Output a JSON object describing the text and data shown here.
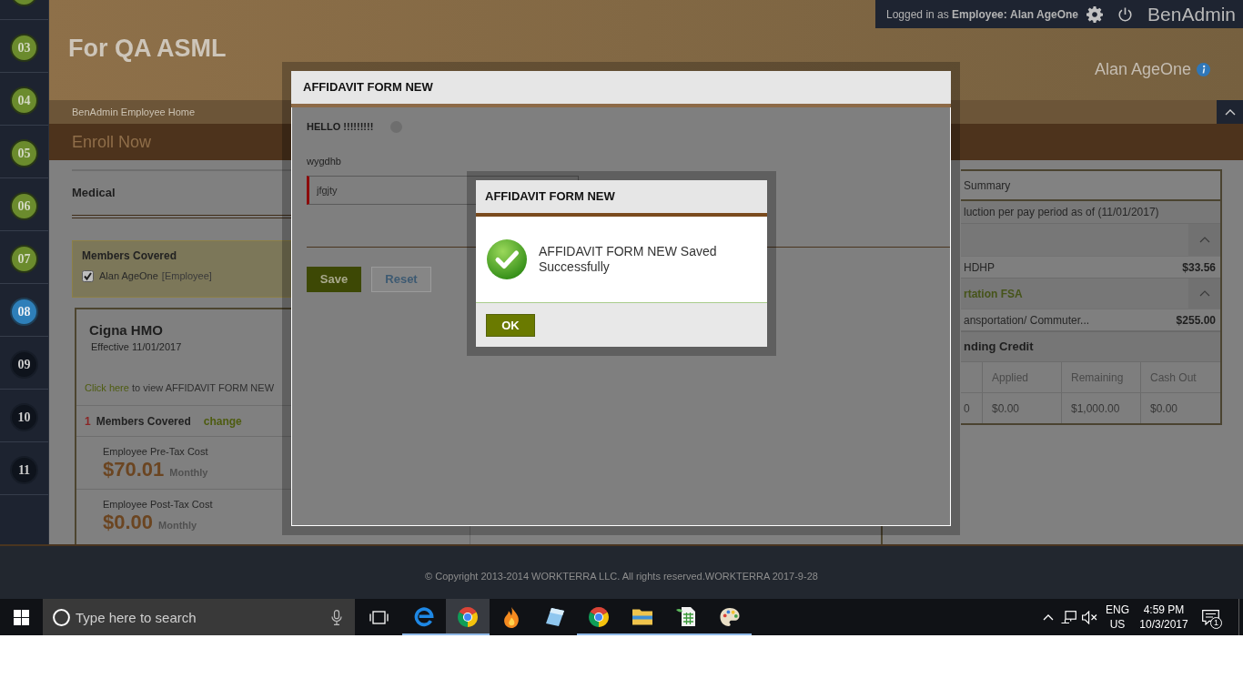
{
  "sidebar": {
    "items": [
      {
        "completed": true,
        "selected": false
      },
      {
        "label": "03",
        "completed": true,
        "selected": false
      },
      {
        "label": "04",
        "completed": true,
        "selected": false
      },
      {
        "label": "05",
        "completed": true,
        "selected": false
      },
      {
        "label": "06",
        "completed": true,
        "selected": false
      },
      {
        "label": "07",
        "completed": true,
        "selected": false
      },
      {
        "label": "08",
        "completed": false,
        "selected": true
      },
      {
        "label": "09",
        "completed": false,
        "selected": false
      },
      {
        "label": "10",
        "completed": false,
        "selected": false
      },
      {
        "label": "11",
        "completed": false,
        "selected": false
      }
    ]
  },
  "header": {
    "title": "For QA ASML",
    "user_name": "Alan AgeOne"
  },
  "top_bar": {
    "login_text": "Logged in as **Employee:** **Alan AgeOne**",
    "brand": "BenAdmin"
  },
  "breadcrumb": "BenAdmin Employee Home",
  "page_heading": "Enroll Now",
  "section": {
    "title": "Medical",
    "members_box": {
      "title": "Members Covered",
      "members": [
        {
          "name": "Alan AgeOne",
          "role": "[Employee]",
          "checked": true
        }
      ]
    },
    "plan_card": {
      "name": "Cigna HMO",
      "effective": "Effective 11/01/2017",
      "form_link": {
        "link": "Click here",
        "text": "to view AFFIDAVIT FORM NEW"
      },
      "members": {
        "count": "1",
        "label": "Members Covered",
        "action": "change"
      },
      "costs": [
        {
          "label": "Employee Pre-Tax Cost",
          "amount": "$70.01",
          "period": "Monthly"
        },
        {
          "label": "Employee Post-Tax Cost",
          "amount": "$0.00",
          "period": "Monthly"
        }
      ]
    }
  },
  "summary_panel": {
    "title": "Summary",
    "subtitle": "luction per pay period as of (11/01/2017)",
    "groups": [
      {
        "expanded": true,
        "items": [
          {
            "name": "HDHP",
            "amount": "$33.56"
          }
        ]
      },
      {
        "title": "rtation FSA",
        "expanded": true,
        "items": [
          {
            "name": "ansportation/ Commuter...",
            "amount": "$255.00"
          }
        ]
      }
    ],
    "credit": {
      "title": "nding Credit",
      "columns": [
        "",
        "Applied",
        "Remaining",
        "Cash Out"
      ],
      "rows": [
        [
          "0",
          "$0.00",
          "$1,000.00",
          "$0.00"
        ]
      ]
    }
  },
  "form_dialog": {
    "title": "AFFIDAVIT FORM NEW",
    "greeting": "HELLO !!!!!!!!!",
    "field_label": "wygdhb",
    "field_value": "jfgjty",
    "buttons": [
      {
        "label": "Save",
        "kind": "primary"
      },
      {
        "label": "Reset",
        "kind": "secondary"
      }
    ]
  },
  "message_dialog": {
    "title": "AFFIDAVIT FORM NEW",
    "message": "AFFIDAVIT FORM NEW Saved Successfully",
    "button": "OK"
  },
  "footer": {
    "copyright": "© Copyright 2013-2014 WORKTERRA LLC. All rights reserved.WORKTERRA 2017-9-28"
  },
  "taskbar": {
    "search_placeholder": "Type here to search",
    "apps": [
      {
        "kind": "e",
        "running": true,
        "selected": false
      },
      {
        "kind": "ring",
        "running": true,
        "selected": true
      },
      {
        "kind": "flame",
        "running": false,
        "selected": false
      },
      {
        "kind": "tile",
        "running": false,
        "selected": false
      },
      {
        "kind": "ring",
        "running": true,
        "selected": false
      },
      {
        "kind": "folder",
        "running": true,
        "selected": false
      },
      {
        "kind": "sheet",
        "running": true,
        "selected": false
      },
      {
        "kind": "palette",
        "running": true,
        "selected": false
      }
    ],
    "tray": {
      "language": "ENG",
      "region": "US",
      "time": "4:59 PM",
      "date": "10/3/2017",
      "notification_count": "1"
    }
  }
}
